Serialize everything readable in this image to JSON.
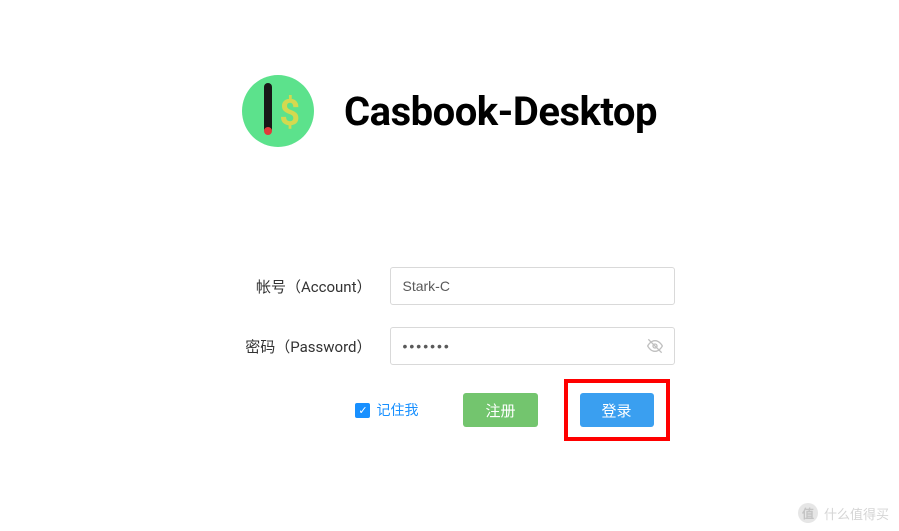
{
  "header": {
    "app_title": "Casbook-Desktop"
  },
  "form": {
    "account_label": "帐号（Account）",
    "account_value": "Stark-C",
    "password_label": "密码（Password）",
    "password_value": "•••••••",
    "remember_label": "记住我",
    "remember_checked": true,
    "register_label": "注册",
    "login_label": "登录"
  },
  "watermark": {
    "badge": "值",
    "text": "什么值得买"
  },
  "icons": {
    "logo": "dollar-bar-icon",
    "eye": "eye-off-icon",
    "check": "check-icon"
  },
  "colors": {
    "primary_blue": "#1890ff",
    "button_blue": "#3a9ff0",
    "button_green": "#73c56e",
    "logo_green": "#5ce28c",
    "highlight_red": "#ff0000"
  }
}
